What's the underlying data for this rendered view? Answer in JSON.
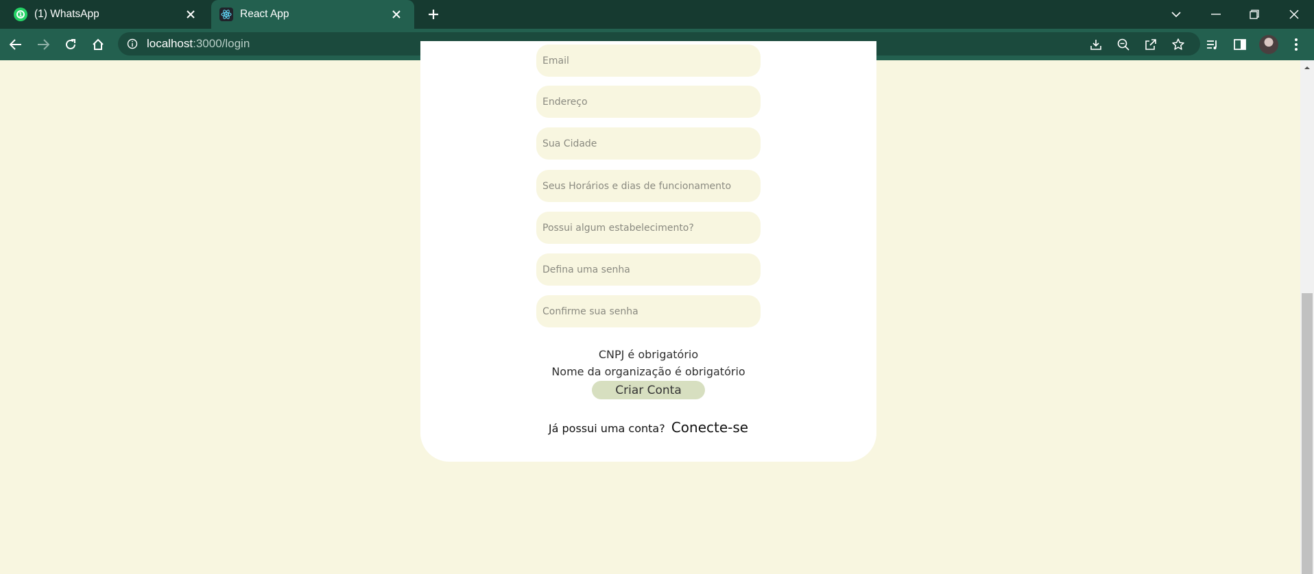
{
  "browser": {
    "tabs": [
      {
        "title": "(1) WhatsApp",
        "badge": "1",
        "icon": "whatsapp-icon"
      },
      {
        "title": "React App",
        "icon": "react-icon"
      }
    ],
    "url_host": "localhost",
    "url_path": ":3000/login",
    "accent": "#23604f",
    "tab_strip_color": "#163a30"
  },
  "form": {
    "fields": [
      {
        "placeholder": "Email"
      },
      {
        "placeholder": "Endereço"
      },
      {
        "placeholder": "Sua Cidade"
      },
      {
        "placeholder": "Seus Horários e dias de funcionamento"
      },
      {
        "placeholder": "Possui algum estabelecimento?"
      },
      {
        "placeholder": "Defina uma senha"
      },
      {
        "placeholder": "Confirme sua senha"
      }
    ],
    "errors": [
      "CNPJ é obrigatório",
      "Nome da organização é obrigatório"
    ],
    "submit_label": "Criar Conta",
    "login_prompt": "Já possui uma conta?",
    "login_link": "Conecte-se",
    "page_background": "#f8f6e0"
  }
}
